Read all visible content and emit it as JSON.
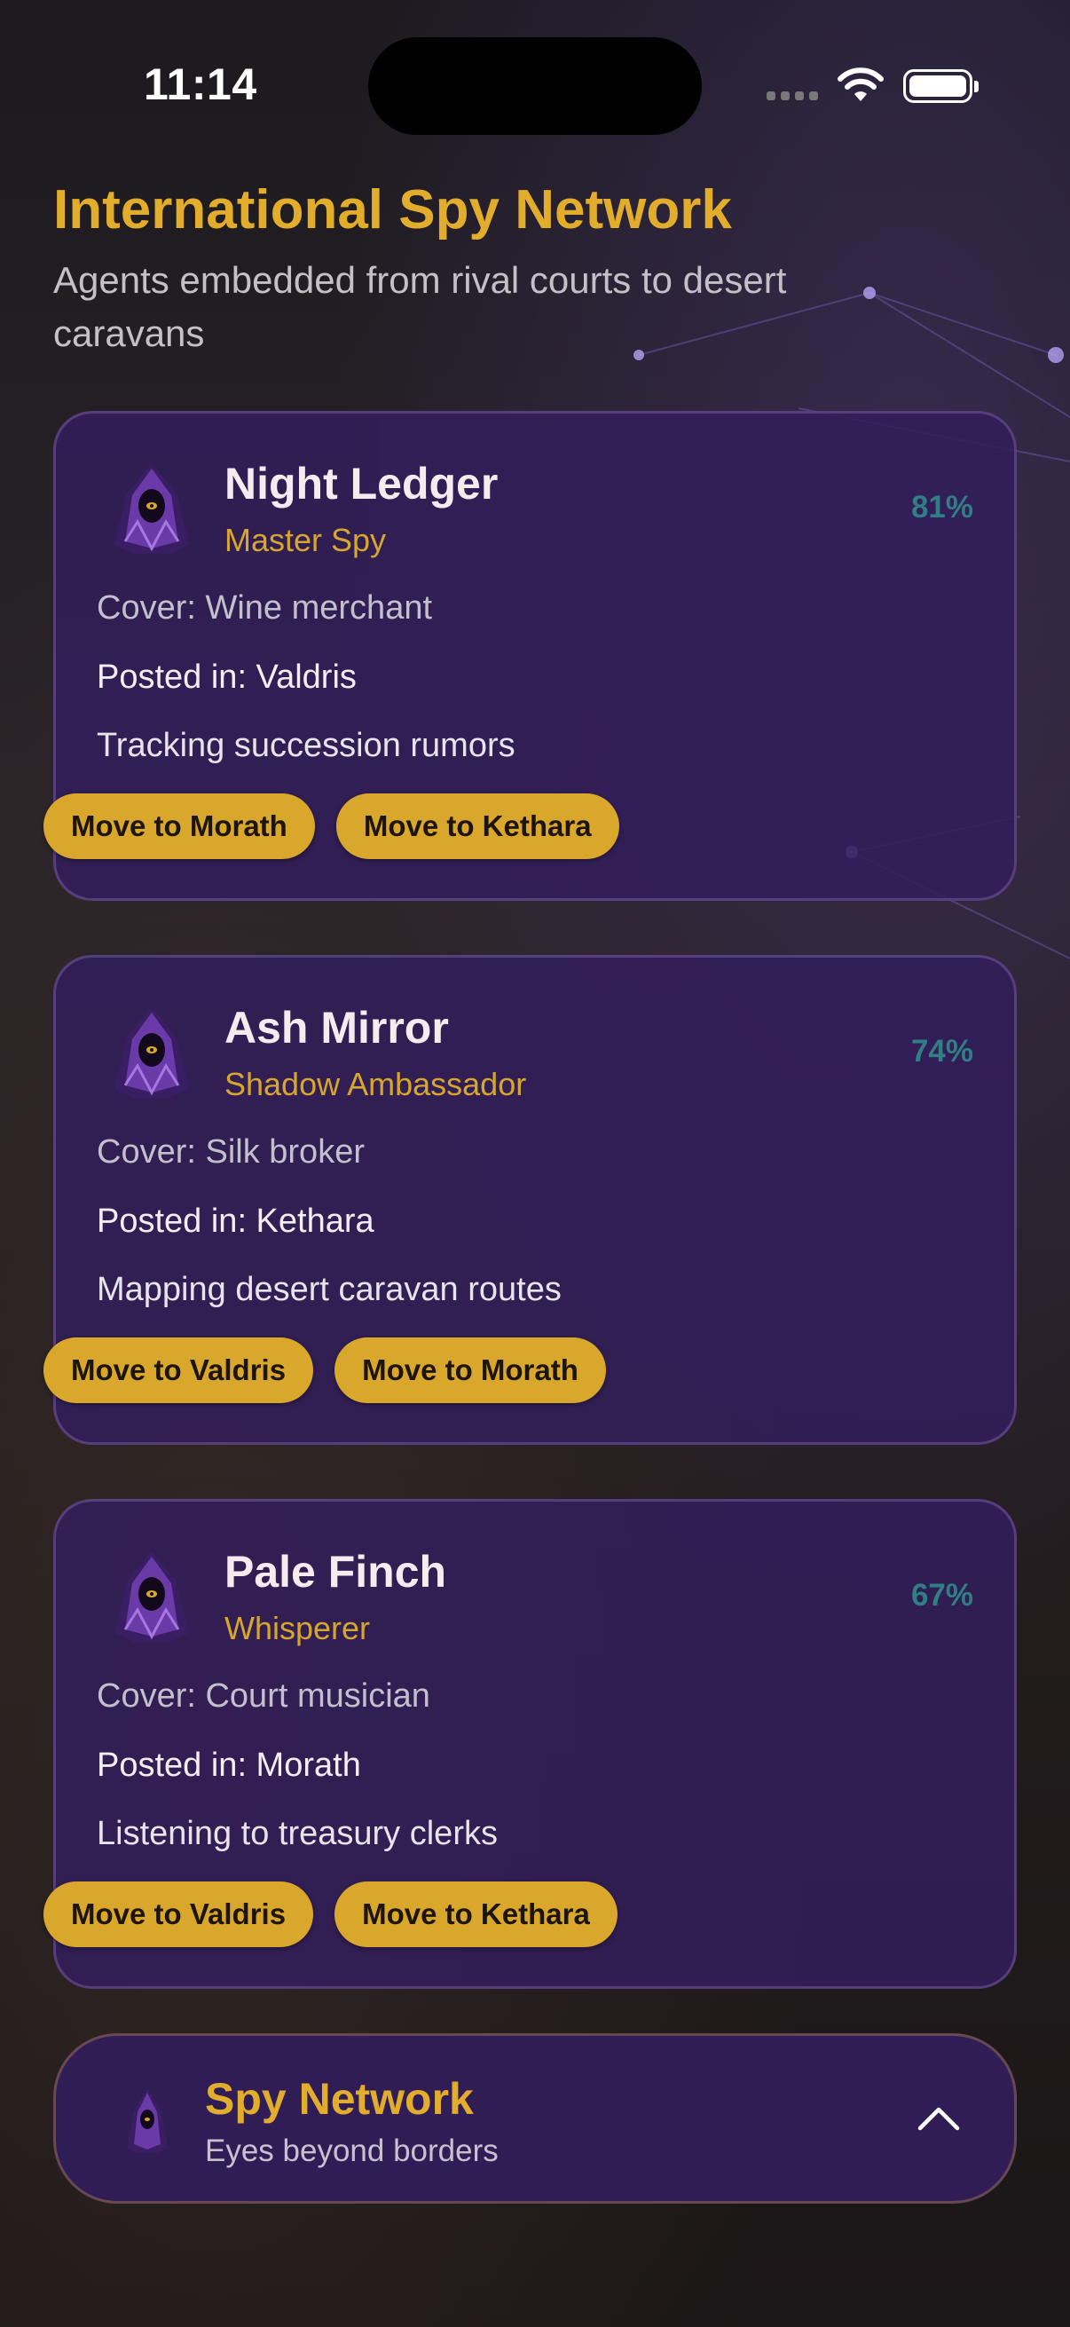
{
  "status_bar": {
    "time": "11:14"
  },
  "header": {
    "title": "International Spy Network",
    "subtitle": "Agents embedded from rival courts to desert caravans"
  },
  "agents": [
    {
      "name": "Night Ledger",
      "role": "Master Spy",
      "percent": "81%",
      "cover": "Cover: Wine merchant",
      "posted": "Posted in: Valdris",
      "task": "Tracking succession rumors",
      "actions": [
        "Move to Morath",
        "Move to Kethara"
      ],
      "avatar_icon": "hooded-spy-icon"
    },
    {
      "name": "Ash Mirror",
      "role": "Shadow Ambassador",
      "percent": "74%",
      "cover": "Cover: Silk broker",
      "posted": "Posted in: Kethara",
      "task": "Mapping desert caravan routes",
      "actions": [
        "Move to Valdris",
        "Move to Morath"
      ],
      "avatar_icon": "hooded-spy-icon"
    },
    {
      "name": "Pale Finch",
      "role": "Whisperer",
      "percent": "67%",
      "cover": "Cover: Court musician",
      "posted": "Posted in: Morath",
      "task": "Listening to treasury clerks",
      "actions": [
        "Move to Valdris",
        "Move to Kethara"
      ],
      "avatar_icon": "hooded-spy-icon"
    }
  ],
  "bottom_bar": {
    "title": "Spy Network",
    "subtitle": "Eyes beyond borders",
    "toggle_icon": "chevron-up-icon"
  },
  "colors": {
    "accent_gold": "#e2ad2c",
    "card_background": "#321e5a",
    "percent_teal": "#2f7f84"
  }
}
